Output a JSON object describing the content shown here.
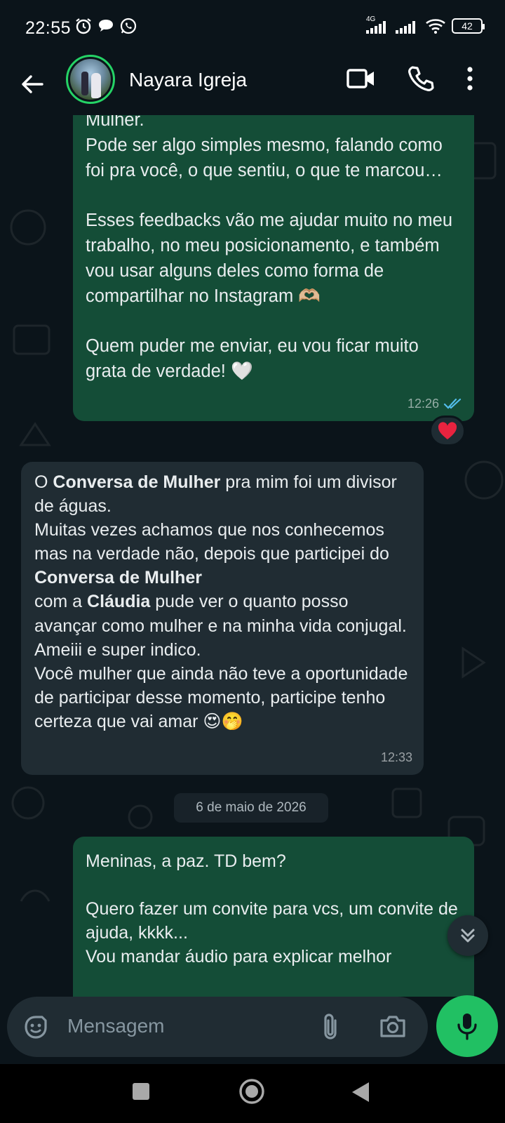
{
  "status_bar": {
    "time": "22:55",
    "network_label": "4G",
    "battery": "42",
    "icons": [
      "alarm-icon",
      "chat-bubble-icon",
      "whatsapp-icon",
      "signal-icon",
      "signal-icon",
      "wifi-icon",
      "battery-icon"
    ]
  },
  "header": {
    "contact_name": "Nayara Igreja",
    "icons": [
      "back-arrow-icon",
      "video-call-icon",
      "phone-icon",
      "more-vert-icon"
    ]
  },
  "messages": [
    {
      "direction": "outgoing",
      "text": "Mulher.\nPode ser algo simples mesmo, falando como foi pra você, o que sentiu, o que te marcou…\n\nEsses feedbacks vão me ajudar muito no meu trabalho, no meu posicionamento, e também vou usar alguns deles como forma de compartilhar no Instagram 🫶🏼\n\nQuem puder me enviar, eu vou ficar muito grata de verdade! 🤍",
      "time": "12:26",
      "status": "read",
      "reaction": "❤️"
    },
    {
      "direction": "incoming",
      "segments": [
        {
          "t": "O "
        },
        {
          "t": "Conversa de Mulher",
          "bold": true
        },
        {
          "t": " pra mim foi um divisor de águas.\nMuitas vezes achamos que nos conhecemos mas na verdade não, depois que participei do "
        },
        {
          "t": "Conversa de Mulher",
          "bold": true
        },
        {
          "t": "\ncom a "
        },
        {
          "t": "Cláudia",
          "bold": true
        },
        {
          "t": " pude ver o quanto posso avançar como mulher e na minha vida conjugal. Ameiii e super indico.\nVocê mulher que ainda não teve a oportunidade de participar desse momento, participe tenho certeza que vai amar 😍🤭"
        }
      ],
      "time": "12:33"
    },
    {
      "direction": "outgoing",
      "text": "Meninas, a paz. TD bem?\n\nQuero fazer um convite para vcs, um convite de ajuda, kkkk...\nVou mandar áudio para explicar melhor"
    }
  ],
  "date_separator": "6 de maio de 2026",
  "input": {
    "placeholder": "Mensagem",
    "icons": [
      "sticker-icon",
      "attach-icon",
      "camera-icon",
      "mic-icon"
    ]
  },
  "nav_bar": {
    "icons": [
      "recents-square-icon",
      "home-circle-icon",
      "back-triangle-icon"
    ]
  },
  "colors": {
    "background": "#0b141a",
    "outgoing_bubble": "#144d37",
    "incoming_bubble": "#202c33",
    "accent_green": "#21c063",
    "read_ticks": "#53bdeb"
  }
}
